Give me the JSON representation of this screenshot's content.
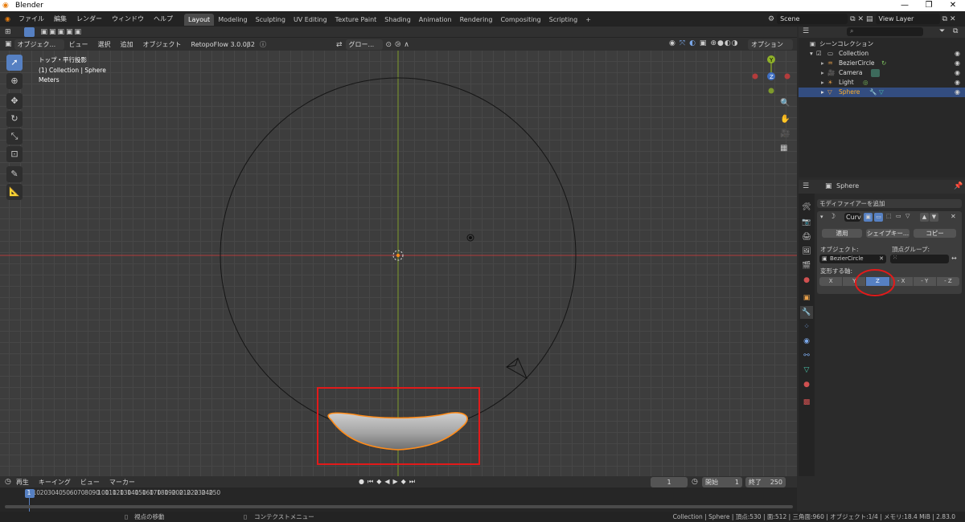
{
  "window": {
    "title": "Blender",
    "controls": [
      "—",
      "❐",
      "✕"
    ]
  },
  "menubar": {
    "items": [
      "ファイル",
      "編集",
      "レンダー",
      "ウィンドウ",
      "ヘルプ"
    ]
  },
  "workspaces": {
    "tabs": [
      "Layout",
      "Modeling",
      "Sculpting",
      "UV Editing",
      "Texture Paint",
      "Shading",
      "Animation",
      "Rendering",
      "Compositing",
      "Scripting"
    ],
    "add": "+",
    "active": "Layout"
  },
  "scene": {
    "label": "Scene",
    "view_layer": "View Layer"
  },
  "tool_header": {
    "mode": "オブジェク...",
    "menus": [
      "ビュー",
      "選択",
      "追加",
      "オブジェクト"
    ],
    "addon": "RetopoFlow 3.0.0β2",
    "transform": "グロー...",
    "options": "オプション"
  },
  "viewport": {
    "info_line1": "トップ・平行投影",
    "info_line2": "(1) Collection | Sphere",
    "info_line3": "Meters",
    "gizmo": {
      "y": "Y",
      "z": "Z"
    }
  },
  "outliner": {
    "header_search": "",
    "root": "シーンコレクション",
    "collection": "Collection",
    "items": [
      {
        "name": "BezierCircle"
      },
      {
        "name": "Camera"
      },
      {
        "name": "Light"
      },
      {
        "name": "Sphere",
        "selected": true
      }
    ]
  },
  "properties": {
    "object_name": "Sphere",
    "add_modifier": "モディファイアーを追加",
    "modifier_name": "Curv",
    "apply": "適用",
    "shapekey": "シェイプキー...",
    "copy": "コピー",
    "object_label": "オブジェクト:",
    "object_value": "BezierCircle",
    "vgroup_label": "頂点グループ:",
    "axis_label": "変形する軸:",
    "axes": [
      "X",
      "Y",
      "Z",
      "- X",
      "- Y",
      "- Z"
    ],
    "active_axis": "Z"
  },
  "timeline": {
    "menus": [
      "再生",
      "キーイング",
      "ビュー",
      "マーカー"
    ],
    "current_frame": "1",
    "start_label": "開始",
    "start": "1",
    "end_label": "終了",
    "end": "250",
    "ticks": [
      "1",
      "10",
      "20",
      "30",
      "40",
      "50",
      "60",
      "70",
      "80",
      "90",
      "100",
      "110",
      "120",
      "130",
      "140",
      "150",
      "160",
      "170",
      "180",
      "190",
      "200",
      "210",
      "220",
      "230",
      "240",
      "250"
    ]
  },
  "statusbar": {
    "left1": "視点の移動",
    "left2": "コンテクストメニュー",
    "right": "Collection | Sphere | 頂点:530 | 面:512 | 三角面:960 | オブジェクト:1/4 | メモリ:18.4 MiB | 2.83.0"
  },
  "colors": {
    "accent": "#5680c2",
    "highlight": "#ff8c1a",
    "annotation": "#e21a1a",
    "x_axis": "#b33c3c",
    "y_axis": "#7e9a2b"
  }
}
